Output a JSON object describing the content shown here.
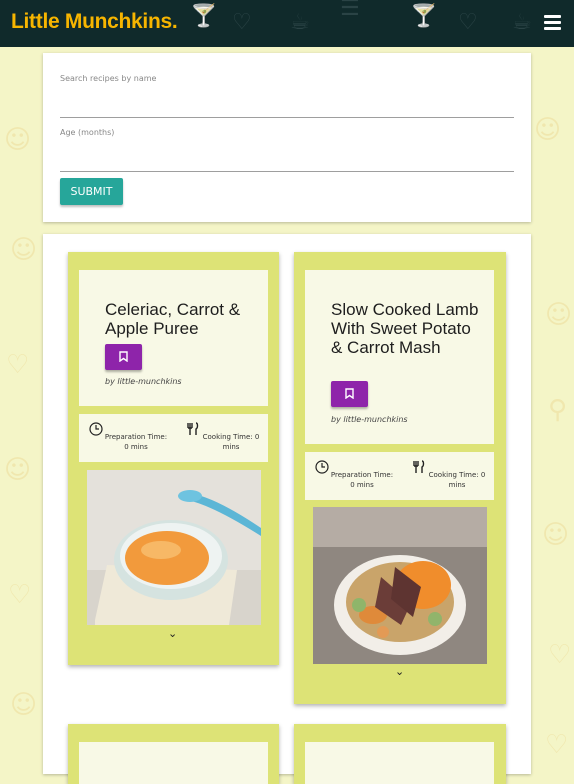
{
  "header": {
    "brand": "Little Munchkins.",
    "menu_icon": "hamburger-menu-icon"
  },
  "search": {
    "name_label": "Search recipes by name",
    "name_value": "",
    "age_label": "Age (months)",
    "age_value": "",
    "submit_label": "SUBMIT"
  },
  "recipes": [
    {
      "title": "Celeriac, Carrot & Apple Puree",
      "author": "by little-munchkins",
      "prep_label": "Preparation Time: 0 mins",
      "cook_label": "Cooking Time: 0 mins",
      "bookmark_icon": "bookmark-icon",
      "expand_icon": "chevron-down-icon"
    },
    {
      "title": "Slow Cooked Lamb With Sweet Potato & Carrot Mash",
      "author": "by little-munchkins",
      "prep_label": "Preparation Time: 0 mins",
      "cook_label": "Cooking Time: 0 mins",
      "bookmark_icon": "bookmark-icon",
      "expand_icon": "chevron-down-icon"
    }
  ],
  "colors": {
    "header_bg": "#102a2b",
    "brand": "#f7b500",
    "page_bg": "#f4f5c7",
    "card_bg": "#dde376",
    "card_inner": "#f8f9e6",
    "submit": "#26a69a",
    "bookmark": "#8e24aa"
  }
}
